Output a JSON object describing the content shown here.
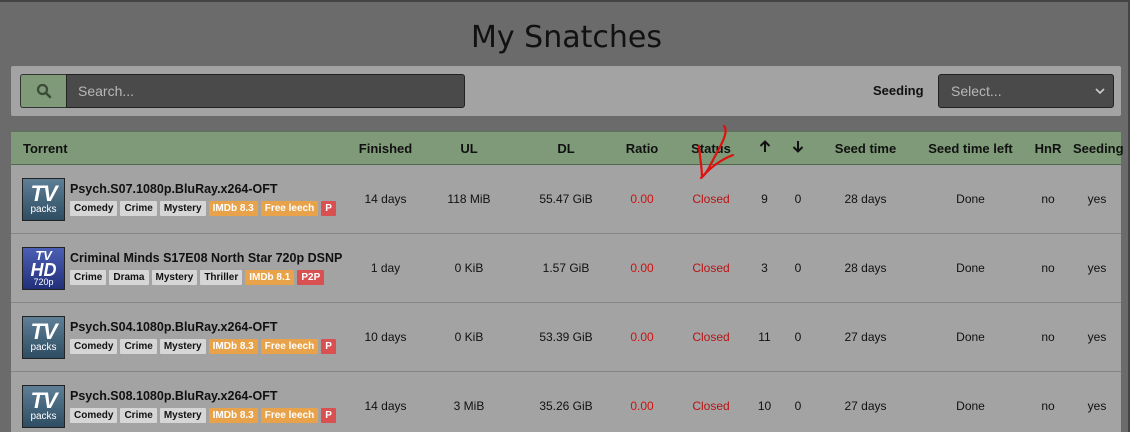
{
  "page": {
    "title": "My Snatches"
  },
  "search": {
    "placeholder": "Search..."
  },
  "filter": {
    "seeding_label": "Seeding",
    "seeding_select_value": "Select..."
  },
  "table": {
    "headers": {
      "torrent": "Torrent",
      "finished": "Finished",
      "ul": "UL",
      "dl": "DL",
      "ratio": "Ratio",
      "status": "Status",
      "up_icon": "arrow-up-icon",
      "down_icon": "arrow-down-icon",
      "seed_time": "Seed time",
      "seed_time_left": "Seed time left",
      "hnr": "HnR",
      "seeding": "Seeding"
    },
    "rows": [
      {
        "cover": {
          "big": "TV",
          "small": "packs"
        },
        "name": "Psych.S07.1080p.BluRay.x264-OFT",
        "tags": [
          "Comedy",
          "Crime",
          "Mystery"
        ],
        "imdb": "IMDb 8.3",
        "free": "Free leech",
        "p2p": "P",
        "finished": "14 days",
        "ul": "118 MiB",
        "dl": "55.47 GiB",
        "ratio": "0.00",
        "status": "Closed",
        "up": "9",
        "down": "0",
        "seed_time": "28 days",
        "seed_time_left": "Done",
        "hnr": "no",
        "seeding": "yes"
      },
      {
        "cover": {
          "big": "TV",
          "mid": "HD",
          "small": "720p"
        },
        "name": "Criminal Minds S17E08 North Star 720p DSNP",
        "tags": [
          "Crime",
          "Drama",
          "Mystery",
          "Thriller"
        ],
        "imdb": "IMDb 8.1",
        "p2p": "P2P",
        "finished": "1 day",
        "ul": "0 KiB",
        "dl": "1.57 GiB",
        "ratio": "0.00",
        "status": "Closed",
        "up": "3",
        "down": "0",
        "seed_time": "28 days",
        "seed_time_left": "Done",
        "hnr": "no",
        "seeding": "yes"
      },
      {
        "cover": {
          "big": "TV",
          "small": "packs"
        },
        "name": "Psych.S04.1080p.BluRay.x264-OFT",
        "tags": [
          "Comedy",
          "Crime",
          "Mystery"
        ],
        "imdb": "IMDb 8.3",
        "free": "Free leech",
        "p2p": "P",
        "finished": "10 days",
        "ul": "0 KiB",
        "dl": "53.39 GiB",
        "ratio": "0.00",
        "status": "Closed",
        "up": "11",
        "down": "0",
        "seed_time": "27 days",
        "seed_time_left": "Done",
        "hnr": "no",
        "seeding": "yes"
      },
      {
        "cover": {
          "big": "TV",
          "small": "packs"
        },
        "name": "Psych.S08.1080p.BluRay.x264-OFT",
        "tags": [
          "Comedy",
          "Crime",
          "Mystery"
        ],
        "imdb": "IMDb 8.3",
        "free": "Free leech",
        "p2p": "P",
        "finished": "14 days",
        "ul": "3 MiB",
        "dl": "35.26 GiB",
        "ratio": "0.00",
        "status": "Closed",
        "up": "10",
        "down": "0",
        "seed_time": "27 days",
        "seed_time_left": "Done",
        "hnr": "no",
        "seeding": "yes"
      }
    ]
  },
  "colors": {
    "header_bg": "#7e9a78",
    "row_bg": "#a3a3a3",
    "page_bg": "#6b6b6b",
    "ratio": "#d01010",
    "status": "#b81414",
    "annotation": "#e01010"
  }
}
